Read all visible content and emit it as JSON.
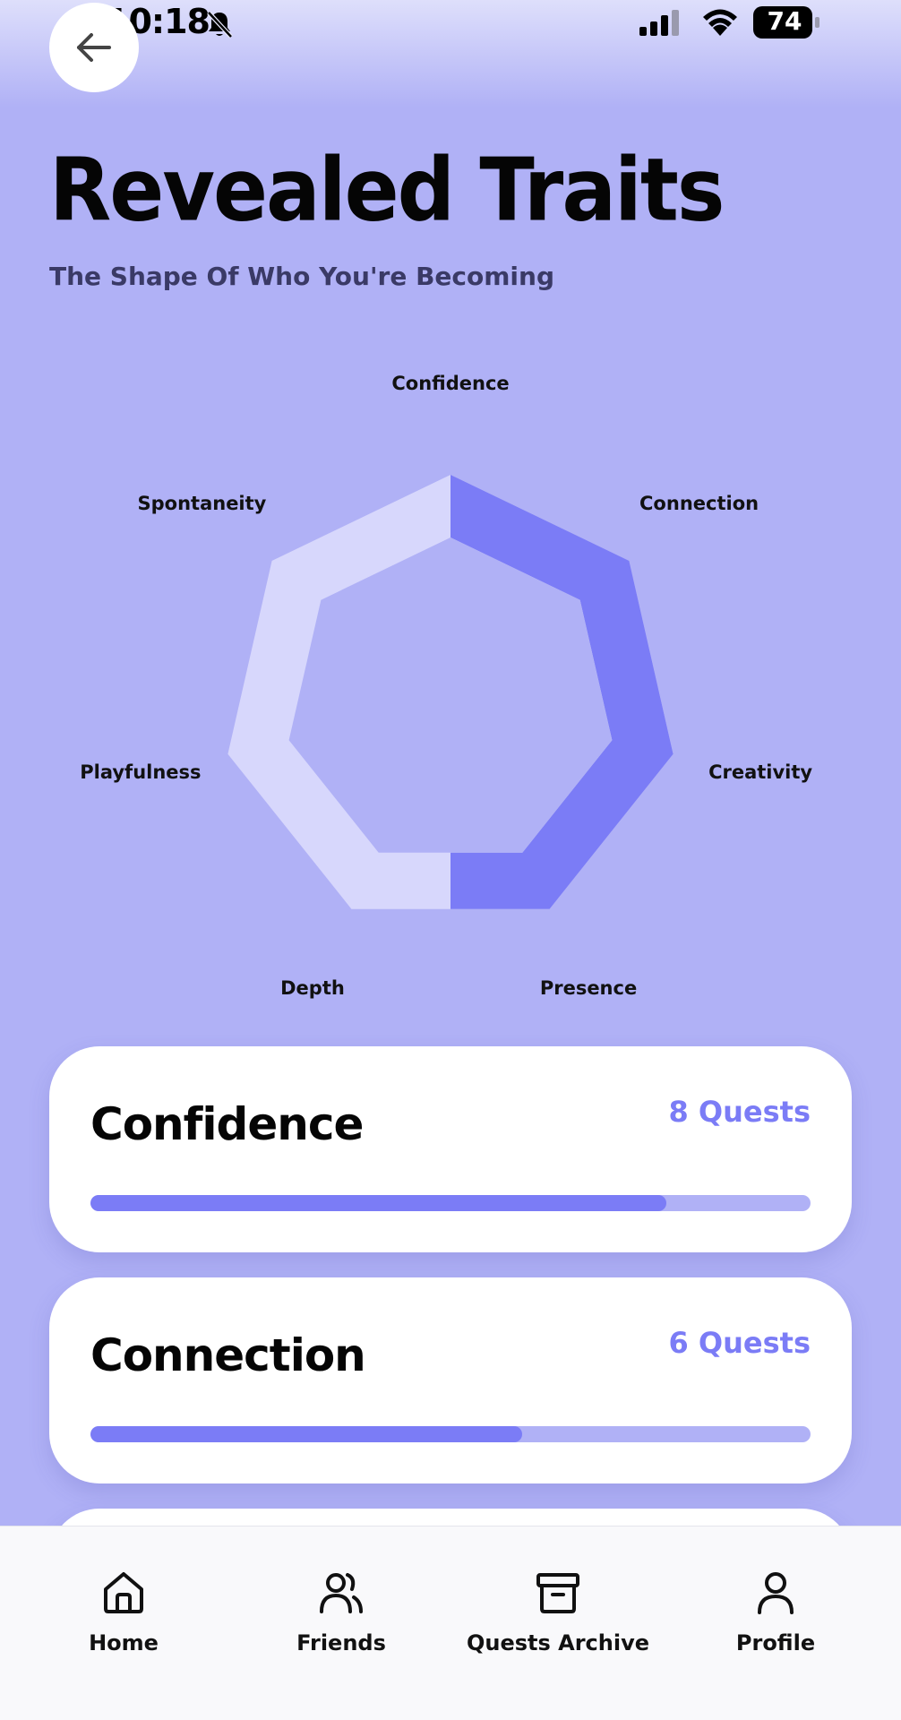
{
  "status_bar": {
    "time": "10:18",
    "battery": "74"
  },
  "header": {
    "title": "Revealed Traits",
    "subtitle": "The Shape Of Who You're Becoming"
  },
  "radar": {
    "labels": [
      "Confidence",
      "Connection",
      "Creativity",
      "Presence",
      "Depth",
      "Playfulness",
      "Spontaneity"
    ],
    "highlighted_arc": {
      "from": "Confidence",
      "to": "Presence"
    },
    "colors": {
      "highlight": "#7b7cf6",
      "base": "#d7d7fc",
      "inner": "#b0b1f6"
    }
  },
  "cards": [
    {
      "name": "Confidence",
      "count": "8 Quests",
      "progress": 0.8
    },
    {
      "name": "Connection",
      "count": "6 Quests",
      "progress": 0.6
    }
  ],
  "nav": [
    {
      "label": "Home",
      "icon": "home-icon"
    },
    {
      "label": "Friends",
      "icon": "friends-icon"
    },
    {
      "label": "Quests Archive",
      "icon": "archive-icon"
    },
    {
      "label": "Profile",
      "icon": "profile-icon"
    }
  ],
  "colors": {
    "background": "#b0b1f6",
    "accent": "#7b7cf6",
    "card": "#ffffff"
  }
}
